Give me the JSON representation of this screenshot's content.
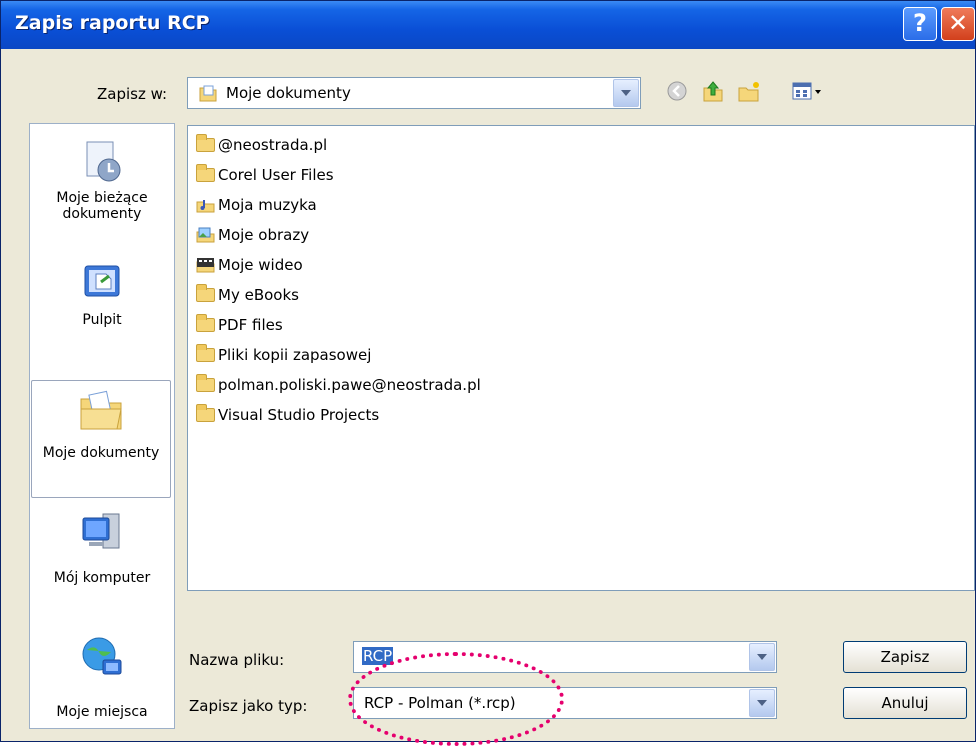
{
  "window": {
    "title": "Zapis raportu RCP",
    "help_label": "?",
    "close_label": "✕"
  },
  "location": {
    "label": "Zapisz w:",
    "value": "Moje dokumenty"
  },
  "toolbar": {
    "icons": [
      "back-icon",
      "up-folder-icon",
      "new-folder-icon",
      "view-menu-icon"
    ]
  },
  "places": [
    {
      "line1": "Moje bieżące",
      "line2": "dokumenty"
    },
    {
      "line1": "Pulpit",
      "line2": ""
    },
    {
      "line1": "Moje dokumenty",
      "line2": ""
    },
    {
      "line1": "Mój komputer",
      "line2": ""
    },
    {
      "line1": "Moje miejsca",
      "line2": ""
    }
  ],
  "files": [
    {
      "name": "@neostrada.pl",
      "icon": "folder-icon"
    },
    {
      "name": "Corel User Files",
      "icon": "folder-icon"
    },
    {
      "name": "Moja muzyka",
      "icon": "music-folder-icon"
    },
    {
      "name": "Moje obrazy",
      "icon": "pictures-folder-icon"
    },
    {
      "name": "Moje wideo",
      "icon": "video-folder-icon"
    },
    {
      "name": "My eBooks",
      "icon": "folder-icon"
    },
    {
      "name": "PDF files",
      "icon": "folder-icon"
    },
    {
      "name": "Pliki kopii zapasowej",
      "icon": "folder-icon"
    },
    {
      "name": "polman.poliski.pawe@neostrada.pl",
      "icon": "folder-icon"
    },
    {
      "name": "Visual Studio Projects",
      "icon": "folder-icon"
    }
  ],
  "filename": {
    "label": "Nazwa pliku:",
    "value": "RCP"
  },
  "filetype": {
    "label": "Zapisz jako typ:",
    "value": "RCP - Polman (*.rcp)"
  },
  "buttons": {
    "save": "Zapisz",
    "cancel": "Anuluj"
  },
  "colors": {
    "title_bar": "#0a4fd6",
    "selection": "#316ac5",
    "annotation": "#e5006e"
  }
}
